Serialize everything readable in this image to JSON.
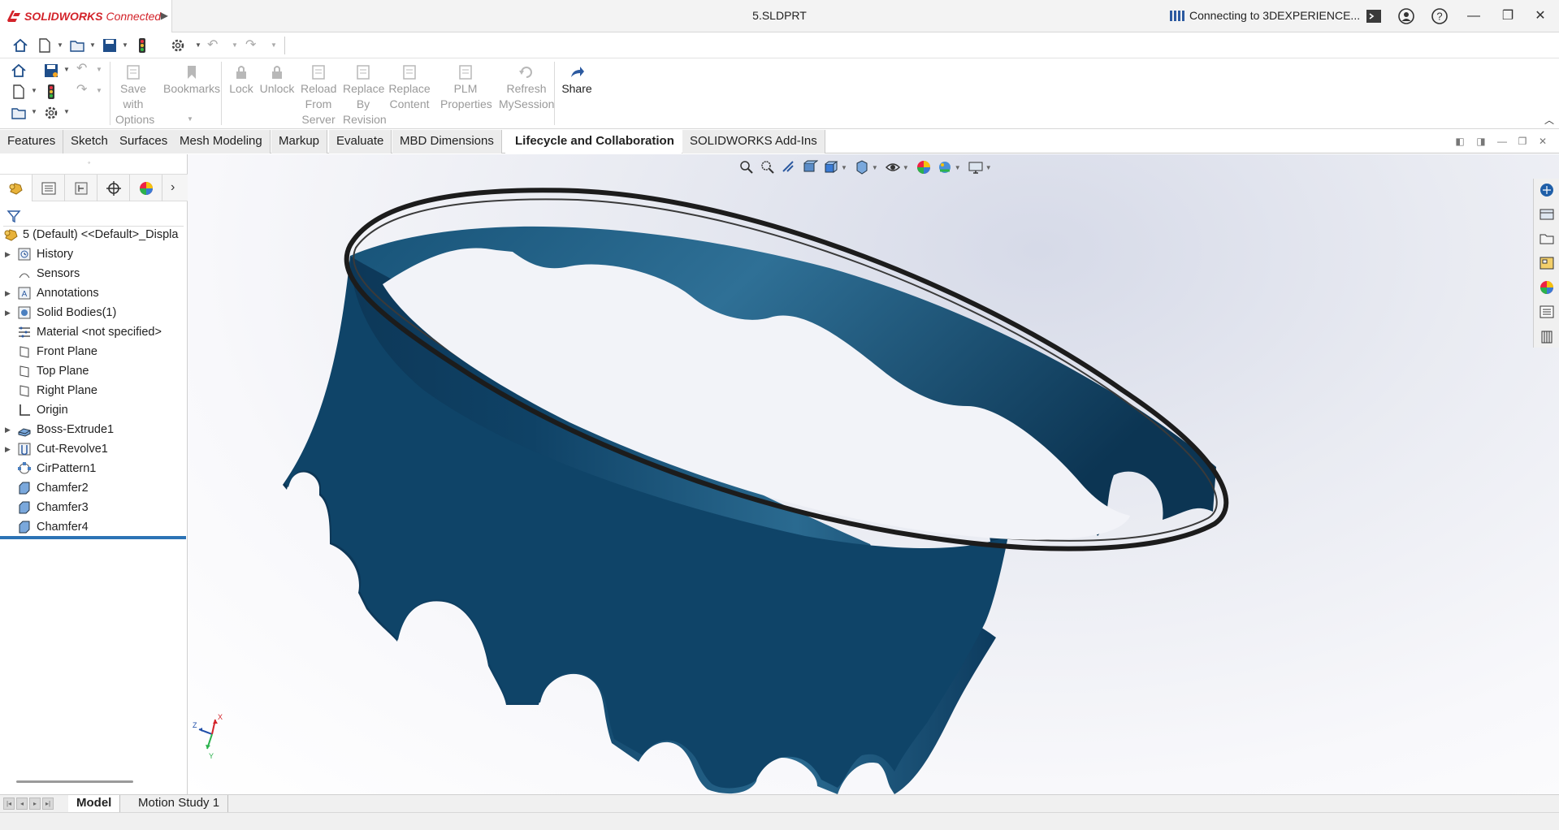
{
  "titlebar": {
    "brand_bold": "SOLIDWORKS",
    "brand_rest": "Connected",
    "document": "5.SLDPRT",
    "status": "Connecting to 3DEXPERIENCE...",
    "accent": "#d3232a"
  },
  "command_manager": {
    "buttons": [
      {
        "label": "Save with Options",
        "lines": [
          "Save",
          "with",
          "Options"
        ],
        "icon": "save-options-icon",
        "enabled": false
      },
      {
        "label": "Bookmarks",
        "lines": [
          "Bookmarks"
        ],
        "icon": "bookmark-icon",
        "enabled": false
      },
      {
        "label": "Lock",
        "lines": [
          "Lock"
        ],
        "icon": "lock-icon",
        "enabled": false
      },
      {
        "label": "Unlock",
        "lines": [
          "Unlock"
        ],
        "icon": "unlock-icon",
        "enabled": false
      },
      {
        "label": "Reload From Server",
        "lines": [
          "Reload",
          "From",
          "Server"
        ],
        "icon": "reload-icon",
        "enabled": false
      },
      {
        "label": "Replace By Revision",
        "lines": [
          "Replace",
          "By",
          "Revision"
        ],
        "icon": "replace-revision-icon",
        "enabled": false
      },
      {
        "label": "Replace Content",
        "lines": [
          "Replace",
          "Content"
        ],
        "icon": "replace-content-icon",
        "enabled": false
      },
      {
        "label": "PLM Properties",
        "lines": [
          "PLM",
          "Properties"
        ],
        "icon": "plm-properties-icon",
        "enabled": false
      },
      {
        "label": "Refresh MySession",
        "lines": [
          "Refresh",
          "MySession"
        ],
        "icon": "refresh-icon",
        "enabled": false
      },
      {
        "label": "Share",
        "lines": [
          "Share"
        ],
        "icon": "share-icon",
        "enabled": true
      }
    ]
  },
  "tabs": [
    {
      "label": "Features",
      "active": false
    },
    {
      "label": "Sketch",
      "active": false
    },
    {
      "label": "Surfaces",
      "active": false
    },
    {
      "label": "Mesh Modeling",
      "active": false
    },
    {
      "label": "Markup",
      "active": false
    },
    {
      "label": "Evaluate",
      "active": false
    },
    {
      "label": "MBD Dimensions",
      "active": false
    },
    {
      "label": "Lifecycle and Collaboration",
      "active": true
    },
    {
      "label": "SOLIDWORKS Add-Ins",
      "active": false
    }
  ],
  "feature_tree": {
    "root": "5 (Default) <<Default>_Displa",
    "items": [
      {
        "label": "History",
        "expandable": true,
        "icon": "history-icon"
      },
      {
        "label": "Sensors",
        "expandable": false,
        "icon": "sensor-icon"
      },
      {
        "label": "Annotations",
        "expandable": true,
        "icon": "annotation-icon"
      },
      {
        "label": "Solid Bodies(1)",
        "expandable": true,
        "icon": "solid-bodies-icon"
      },
      {
        "label": "Material <not specified>",
        "expandable": false,
        "icon": "material-icon"
      },
      {
        "label": "Front Plane",
        "expandable": false,
        "icon": "plane-icon"
      },
      {
        "label": "Top Plane",
        "expandable": false,
        "icon": "plane-icon"
      },
      {
        "label": "Right Plane",
        "expandable": false,
        "icon": "plane-icon"
      },
      {
        "label": "Origin",
        "expandable": false,
        "icon": "origin-icon"
      },
      {
        "label": "Boss-Extrude1",
        "expandable": true,
        "icon": "extrude-icon"
      },
      {
        "label": "Cut-Revolve1",
        "expandable": true,
        "icon": "cut-revolve-icon"
      },
      {
        "label": "CirPattern1",
        "expandable": false,
        "icon": "circular-pattern-icon"
      },
      {
        "label": "Chamfer2",
        "expandable": false,
        "icon": "chamfer-icon"
      },
      {
        "label": "Chamfer3",
        "expandable": false,
        "icon": "chamfer-icon"
      },
      {
        "label": "Chamfer4",
        "expandable": false,
        "icon": "chamfer-icon"
      }
    ]
  },
  "model": {
    "color": "#1f5a7d",
    "triad_axes": [
      "Z",
      "X",
      "Y"
    ]
  },
  "bottom_tabs": [
    {
      "label": "Model",
      "active": true
    },
    {
      "label": "Motion Study 1",
      "active": false
    }
  ]
}
